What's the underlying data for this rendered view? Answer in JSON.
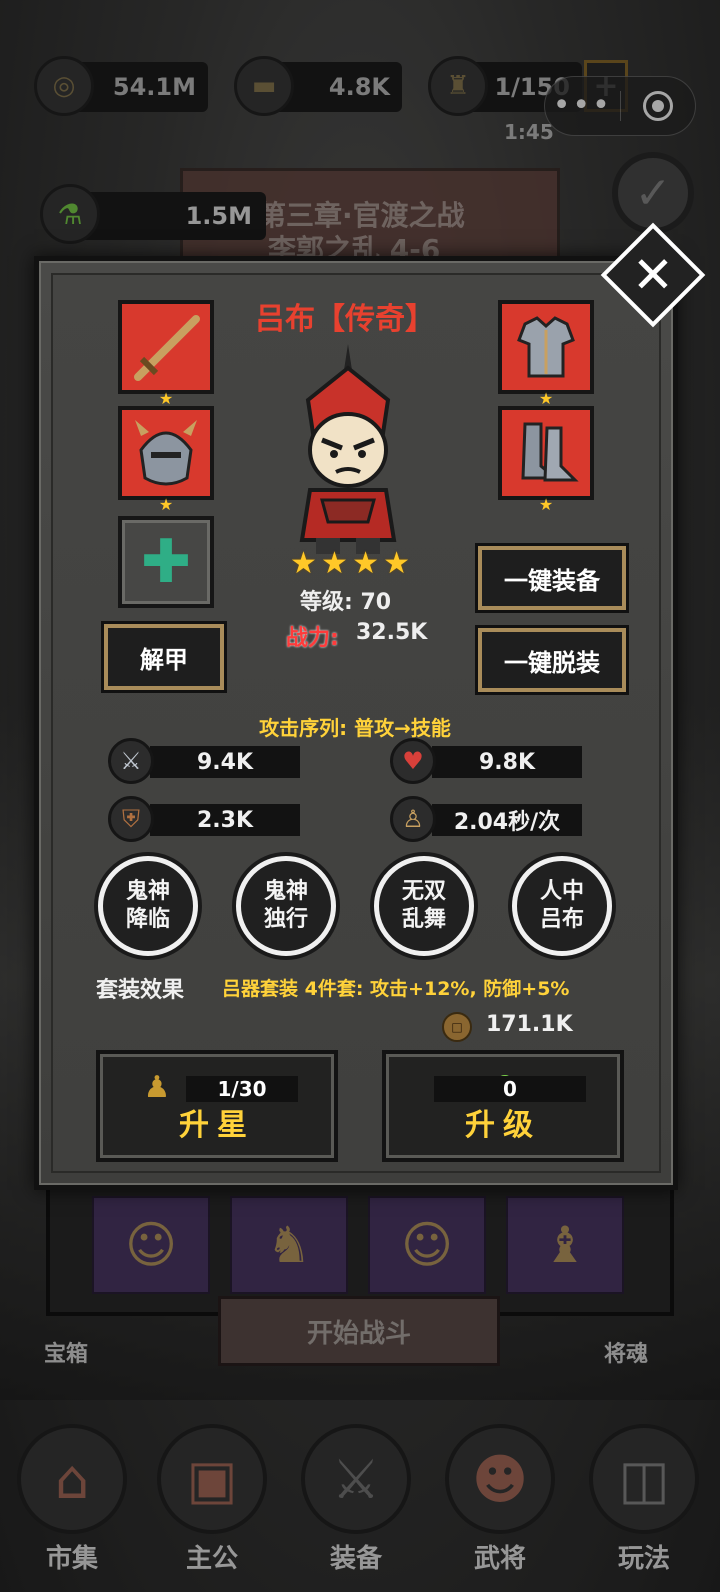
{
  "resources": {
    "copper": "54.1M",
    "gold": "4.8K",
    "stamina": "1/150",
    "plus": "+",
    "timer": "1:45",
    "potion": "1.5M"
  },
  "capsule": {
    "more": "•••",
    "close": "◎"
  },
  "chapter": {
    "title": "第三章·官渡之战",
    "subtitle": "李郭之乱 4-6"
  },
  "hero": {
    "name": "吕布【传奇】",
    "stars": 4,
    "level_text": "等级: 70",
    "power_label": "战力:",
    "power_value": "32.5K",
    "attack_sequence": "攻击序列: 普攻→技能",
    "stats": {
      "attack": "9.4K",
      "hp": "9.8K",
      "defense": "2.3K",
      "speed": "2.04秒/次"
    },
    "skills": [
      {
        "line1": "鬼神",
        "line2": "降临"
      },
      {
        "line1": "鬼神",
        "line2": "独行"
      },
      {
        "line1": "无双",
        "line2": "乱舞"
      },
      {
        "line1": "人中",
        "line2": "吕布"
      }
    ],
    "set_label": "套装效果",
    "set_effect": "吕器套装 4件套: 攻击+12%, 防御+5%",
    "upgrade_cost": "171.1K",
    "star_up": {
      "progress": "1/30",
      "label": "升星"
    },
    "level_up": {
      "count": "0",
      "label": "升级"
    }
  },
  "buttons": {
    "unequip": "解甲",
    "equip_all": "一键装备",
    "remove_all": "一键脱装",
    "close": "✕"
  },
  "background": {
    "start_battle": "开始战斗",
    "chest": "宝箱",
    "soul": "将魂"
  },
  "nav": [
    {
      "label": "市集",
      "icon": "market-icon"
    },
    {
      "label": "主公",
      "icon": "lord-icon"
    },
    {
      "label": "装备",
      "icon": "swords-icon"
    },
    {
      "label": "武将",
      "icon": "general-icon"
    },
    {
      "label": "玩法",
      "icon": "gameplay-icon"
    }
  ],
  "colors": {
    "accent_gold": "#ffd23a",
    "power_red": "#ff3b3b",
    "equip_red": "#d8392d",
    "star_gold": "#ffc828"
  }
}
